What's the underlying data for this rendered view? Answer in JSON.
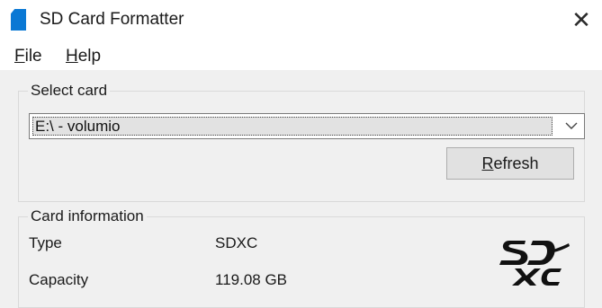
{
  "window": {
    "title": "SD Card Formatter",
    "close_glyph": "✕",
    "app_icon": "sd-card-icon",
    "accent": "#0a78d4"
  },
  "menu": {
    "file": {
      "access_key": "F",
      "rest": "ile"
    },
    "help": {
      "access_key": "H",
      "rest": "elp"
    }
  },
  "select_card": {
    "legend": "Select card",
    "selected_value": "E:\\ - volumio",
    "refresh_label": {
      "access_key": "R",
      "rest": "efresh"
    }
  },
  "card_information": {
    "legend": "Card information",
    "rows": [
      {
        "label": "Type",
        "value": "SDXC"
      },
      {
        "label": "Capacity",
        "value": "119.08 GB"
      }
    ],
    "logo_icon": "sdxc-logo-icon"
  }
}
